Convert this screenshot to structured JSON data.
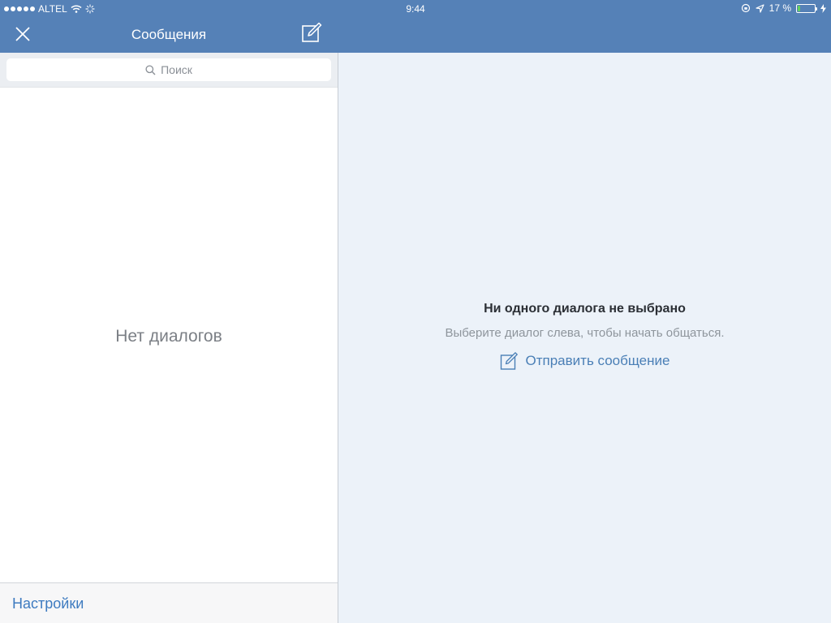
{
  "status_bar": {
    "carrier": "ALTEL",
    "time": "9:44",
    "battery_text": "17 %",
    "battery_level": 0.17
  },
  "nav": {
    "title": "Сообщения"
  },
  "search": {
    "placeholder": "Поиск"
  },
  "left_panel": {
    "empty_text": "Нет диалогов",
    "settings_label": "Настройки"
  },
  "right_panel": {
    "title": "Ни одного диалога не выбрано",
    "subtitle": "Выберите диалог слева, чтобы начать общаться.",
    "send_label": "Отправить сообщение"
  },
  "colors": {
    "nav_bar": "#5581b7",
    "link": "#3e7bc0",
    "right_bg": "#ecf2f9"
  }
}
